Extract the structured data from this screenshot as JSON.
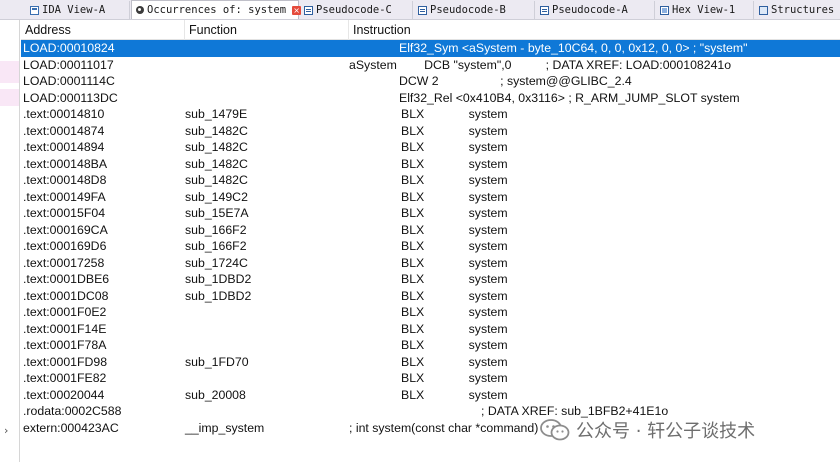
{
  "tabs": [
    {
      "label": "IDA View-A",
      "icon": "ida-view-icon",
      "active": false,
      "closable": false
    },
    {
      "label": "Occurrences of: system",
      "icon": "occurrences-icon",
      "active": true,
      "closable": true
    },
    {
      "label": "Pseudocode-C",
      "icon": "pseudocode-icon",
      "active": false,
      "closable": false
    },
    {
      "label": "Pseudocode-B",
      "icon": "pseudocode-icon",
      "active": false,
      "closable": false
    },
    {
      "label": "Pseudocode-A",
      "icon": "pseudocode-icon",
      "active": false,
      "closable": false
    },
    {
      "label": "Hex View-1",
      "icon": "hex-view-icon",
      "active": false,
      "closable": false
    },
    {
      "label": "Structures",
      "icon": "structures-icon",
      "active": false,
      "closable": false
    }
  ],
  "columns": {
    "address": "Address",
    "function": "Function",
    "instruction": "Instruction"
  },
  "rows": [
    {
      "address": "LOAD:00010824",
      "function": "",
      "instruction": "Elf32_Sym <aSystem - byte_10C64, 0, 0, 0x12, 0, 0> ; \"system\"",
      "selected": true
    },
    {
      "address": "LOAD:00011017",
      "function": "",
      "instruction": "aSystem        DCB \"system\",0          ; DATA XREF: LOAD:000108241o",
      "selected": false
    },
    {
      "address": "LOAD:0001114C",
      "function": "",
      "instruction": "DCW 2                  ; system@@GLIBC_2.4",
      "selected": false
    },
    {
      "address": "LOAD:000113DC",
      "function": "",
      "instruction": "Elf32_Rel <0x410B4, 0x3116> ; R_ARM_JUMP_SLOT system",
      "selected": false
    },
    {
      "address": ".text:00014810",
      "function": "sub_1479E",
      "instruction": "BLX             system",
      "selected": false
    },
    {
      "address": ".text:00014874",
      "function": "sub_1482C",
      "instruction": "BLX             system",
      "selected": false
    },
    {
      "address": ".text:00014894",
      "function": "sub_1482C",
      "instruction": "BLX             system",
      "selected": false
    },
    {
      "address": ".text:000148BA",
      "function": "sub_1482C",
      "instruction": "BLX             system",
      "selected": false
    },
    {
      "address": ".text:000148D8",
      "function": "sub_1482C",
      "instruction": "BLX             system",
      "selected": false
    },
    {
      "address": ".text:000149FA",
      "function": "sub_149C2",
      "instruction": "BLX             system",
      "selected": false
    },
    {
      "address": ".text:00015F04",
      "function": "sub_15E7A",
      "instruction": "BLX             system",
      "selected": false
    },
    {
      "address": ".text:000169CA",
      "function": "sub_166F2",
      "instruction": "BLX             system",
      "selected": false
    },
    {
      "address": ".text:000169D6",
      "function": "sub_166F2",
      "instruction": "BLX             system",
      "selected": false
    },
    {
      "address": ".text:00017258",
      "function": "sub_1724C",
      "instruction": "BLX             system",
      "selected": false
    },
    {
      "address": ".text:0001DBE6",
      "function": "sub_1DBD2",
      "instruction": "BLX             system",
      "selected": false
    },
    {
      "address": ".text:0001DC08",
      "function": "sub_1DBD2",
      "instruction": "BLX             system",
      "selected": false
    },
    {
      "address": ".text:0001F0E2",
      "function": "",
      "instruction": "BLX             system",
      "selected": false
    },
    {
      "address": ".text:0001F14E",
      "function": "",
      "instruction": "BLX             system",
      "selected": false
    },
    {
      "address": ".text:0001F78A",
      "function": "",
      "instruction": "BLX             system",
      "selected": false
    },
    {
      "address": ".text:0001FD98",
      "function": "sub_1FD70",
      "instruction": "BLX             system",
      "selected": false
    },
    {
      "address": ".text:0001FE82",
      "function": "",
      "instruction": "BLX             system",
      "selected": false
    },
    {
      "address": ".text:00020044",
      "function": "sub_20008",
      "instruction": "BLX             system",
      "selected": false
    },
    {
      "address": ".rodata:0002C588",
      "function": "",
      "instruction": "; DATA XREF: sub_1BFB2+41E1o",
      "selected": false
    },
    {
      "address": "extern:000423AC",
      "function": "__imp_system",
      "instruction": "; int system(const char *command)",
      "selected": false
    }
  ],
  "watermark": {
    "text": "公众号 · 轩公子谈技术"
  },
  "colors": {
    "selection": "#0f78d7",
    "tab_close": "#e54b3c",
    "gutter_mark": "#f9e7f6"
  }
}
